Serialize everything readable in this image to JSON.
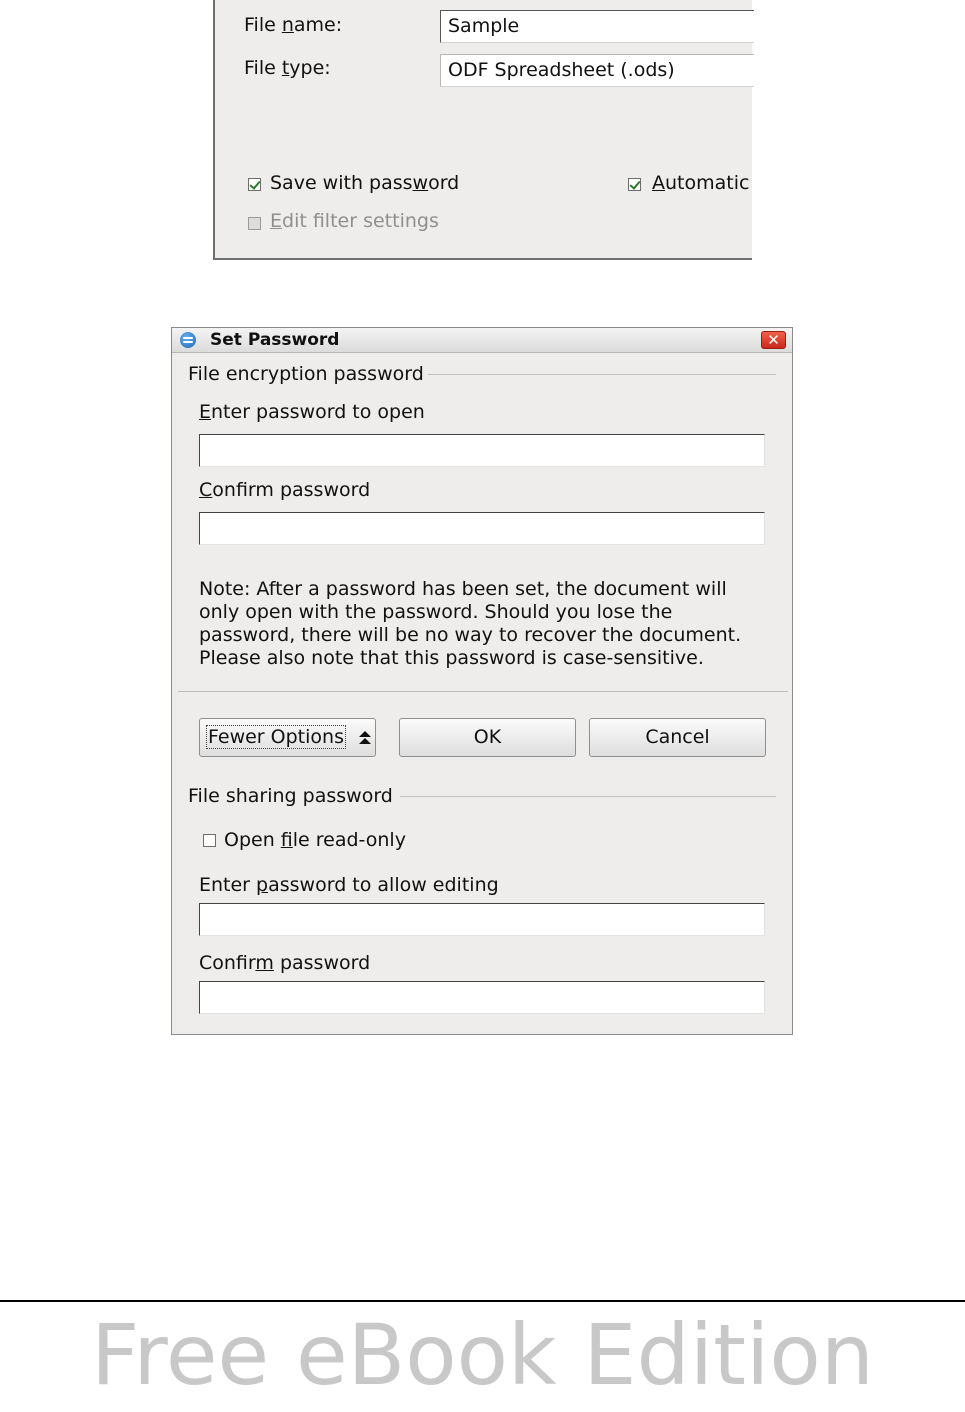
{
  "save_dialog": {
    "file_name_label_pre": "File ",
    "file_name_label_mnemonic": "n",
    "file_name_label_post": "ame:",
    "file_name_value": "Sample",
    "file_type_label_pre": "File ",
    "file_type_label_mnemonic": "t",
    "file_type_label_post": "ype:",
    "file_type_value": "ODF Spreadsheet (.ods)",
    "save_with_password_pre": "Save with pass",
    "save_with_password_mnemonic": "w",
    "save_with_password_post": "ord",
    "save_with_password_checked": true,
    "automatic_mnemonic": "A",
    "automatic_post": "utomatic",
    "automatic_checked": true,
    "edit_filter_mnemonic": "E",
    "edit_filter_post": "dit filter settings",
    "edit_filter_checked": false,
    "edit_filter_disabled": true
  },
  "set_password_dialog": {
    "title": "Set Password",
    "close_glyph": "✕",
    "encryption_group_title": "File encryption password",
    "enter_open_label_mnemonic": "E",
    "enter_open_label_post": "nter password to open",
    "confirm1_label_mnemonic": "C",
    "confirm1_label_post": "onfirm password",
    "note": "Note: After a password has been set, the document will only open with the password. Should you lose the password, there will be no way to recover the document. Please also note that this password is case-sensitive.",
    "fewer_options_label": "Fewer Options",
    "ok_label": "OK",
    "cancel_label": "Cancel",
    "sharing_group_title": "File sharing password",
    "read_only_pre": "Open ",
    "read_only_mnemonic": "f",
    "read_only_post": "ile read-only",
    "read_only_checked": false,
    "enter_edit_label_pre": "Enter ",
    "enter_edit_label_mnemonic": "p",
    "enter_edit_label_post": "assword to allow editing",
    "confirm2_label_pre": "Confir",
    "confirm2_label_mnemonic": "m",
    "confirm2_label_post": " password"
  },
  "footer": {
    "text": "Free eBook Edition"
  }
}
